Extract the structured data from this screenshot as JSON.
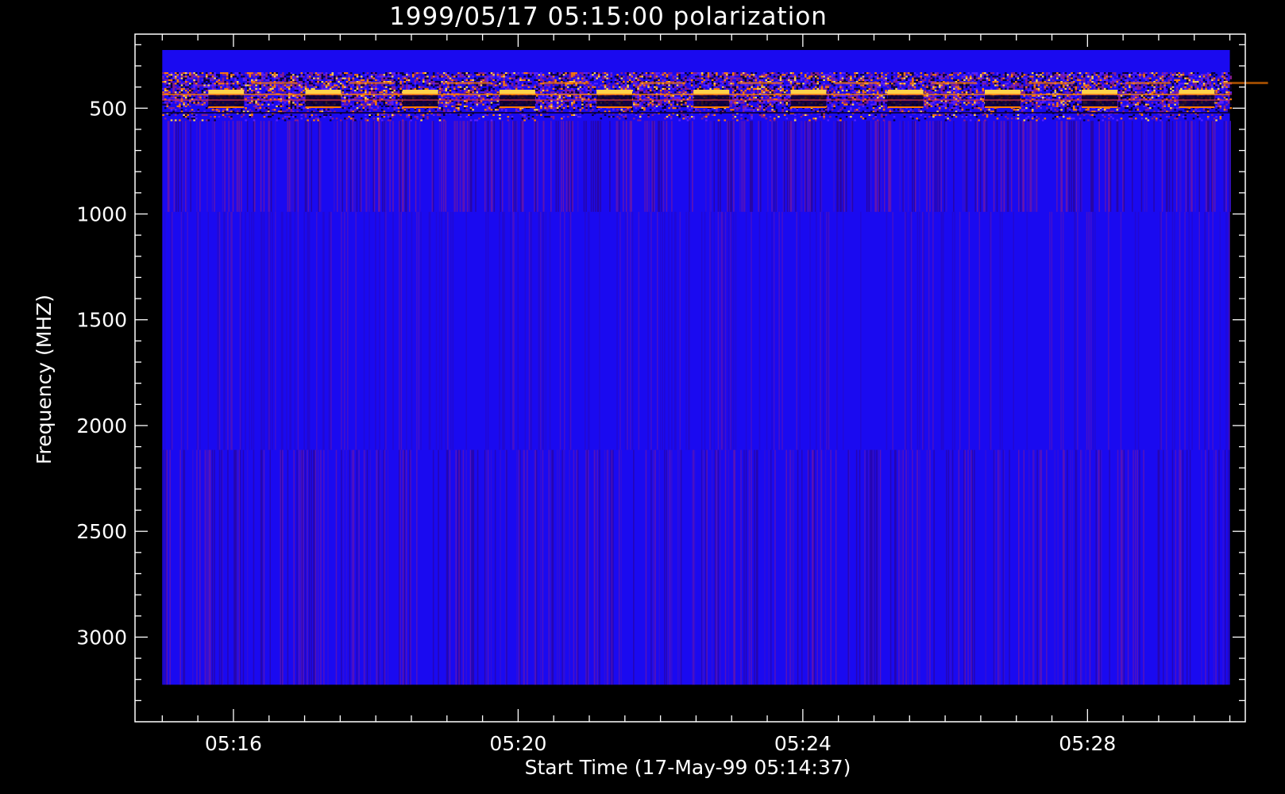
{
  "chart_data": {
    "type": "heatmap",
    "title": "1999/05/17 05:15:00 polarization",
    "xlabel": "Start Time (17-May-99 05:14:37)",
    "ylabel": "Frequency (MHZ)",
    "x_ticks": [
      "05:16",
      "05:20",
      "05:24",
      "05:28"
    ],
    "x_tick_values_min": [
      1.383,
      5.383,
      9.383,
      13.383
    ],
    "xlim_min": [
      0,
      15.6
    ],
    "data_x_range_min": [
      0.383,
      15.383
    ],
    "y_ticks": [
      "500",
      "1000",
      "1500",
      "2000",
      "2500",
      "3000"
    ],
    "y_tick_values": [
      500,
      1000,
      1500,
      2000,
      2500,
      3000
    ],
    "ylim": [
      3400,
      150
    ],
    "y_inverted": true,
    "data_y_range": [
      225,
      3225
    ],
    "y_minor_step": 100,
    "x_minor_step_min": 0.5,
    "grid": false,
    "legend": "none",
    "frequency_bands": [
      {
        "from": 225,
        "to": 330,
        "appearance": "uniform blue"
      },
      {
        "from": 330,
        "to": 560,
        "appearance": "strong mixed emission with bright orange/yellow horizontal lines"
      },
      {
        "from": 560,
        "to": 990,
        "appearance": "blue with vertical streaks"
      },
      {
        "from": 990,
        "to": 2115,
        "appearance": "blue with faint vertical streaks"
      },
      {
        "from": 2115,
        "to": 3225,
        "appearance": "blue with vertical streaks"
      }
    ],
    "colors": {
      "background": "#000000",
      "axes": "#ffffff",
      "base": "#1a0af0",
      "dim": "#2c0590",
      "magenta": "#8a1c8c",
      "orange": "#ff7a00",
      "yellow": "#ffd24a"
    }
  }
}
